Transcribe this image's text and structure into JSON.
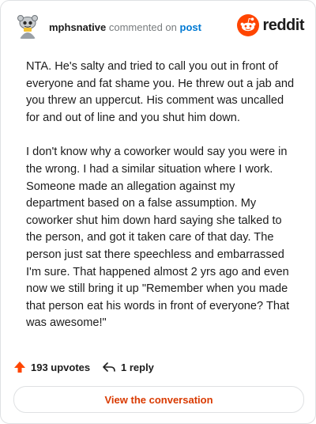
{
  "header": {
    "username": "mphsnative",
    "commented_text": "commented on",
    "post_link": "post",
    "brand_name": "reddit"
  },
  "comment": {
    "paragraphs": [
      "NTA. He's salty and tried to call you out in front of everyone and fat shame you. He threw out a jab and you threw an uppercut. His comment was uncalled for and out of line and you shut him down.",
      "I don't know why a coworker would say you were in the wrong. I had a similar situation where I work. Someone made an allegation against my department based on a false assumption. My coworker shut him down hard saying she talked to the person, and got it taken care of that day. The person just sat there speechless and embarrassed I'm sure. That happened almost 2 yrs ago and even now we still bring it up \"Remember when you made that person eat his words in front of everyone? That was awesome!\""
    ]
  },
  "footer": {
    "upvotes": "193 upvotes",
    "replies": "1 reply",
    "cta_label": "View the conversation"
  },
  "colors": {
    "accent": "#d93a00",
    "reddit_orange": "#ff4500",
    "link_blue": "#0079d3",
    "text": "#1c1c1c",
    "muted": "#787c7e",
    "border": "#dfe1e3"
  },
  "icons": {
    "avatar": "snoo-avatar-icon",
    "brand": "reddit-logo-icon",
    "upvote": "upvote-arrow-icon",
    "reply": "reply-arrow-icon"
  }
}
